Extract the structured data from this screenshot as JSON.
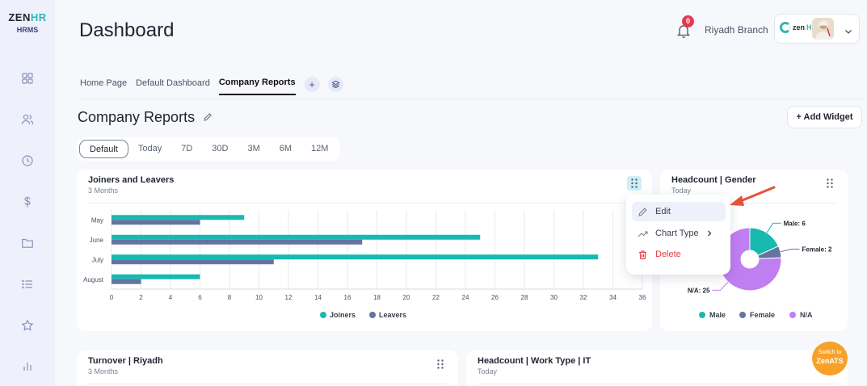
{
  "brand": {
    "logo_main": "ZEN",
    "logo_hr": "HR",
    "logo_sub": "HRMS"
  },
  "header": {
    "title": "Dashboard",
    "notifications_count": "0",
    "branch": "Riyadh Branch",
    "user_logo_text": "zen",
    "user_logo_hr": "HR"
  },
  "tabs": [
    {
      "label": "Home Page"
    },
    {
      "label": "Default Dashboard"
    },
    {
      "label": "Company Reports"
    }
  ],
  "tab_add": "+",
  "section": {
    "title": "Company Reports",
    "add_widget": "+ Add Widget"
  },
  "ranges": [
    {
      "label": "Default"
    },
    {
      "label": "Today"
    },
    {
      "label": "7D"
    },
    {
      "label": "30D"
    },
    {
      "label": "3M"
    },
    {
      "label": "6M"
    },
    {
      "label": "12M"
    }
  ],
  "cards": {
    "joiners": {
      "title": "Joiners and Leavers",
      "subtitle": "3 Months"
    },
    "gender": {
      "title": "Headcount | Gender",
      "subtitle": "Today"
    },
    "turnover": {
      "title": "Turnover | Riyadh",
      "subtitle": "3 Months"
    },
    "worktype": {
      "title": "Headcount | Work Type | IT",
      "subtitle": "Today"
    }
  },
  "context_menu": {
    "edit": "Edit",
    "chart_type": "Chart Type",
    "delete": "Delete"
  },
  "switch_ats": {
    "line1": "Switch to",
    "line2": "ZenATS"
  },
  "colors": {
    "teal": "#17b9b1",
    "slate": "#6474a0",
    "purple": "#c07ff1",
    "danger": "#e5393f",
    "accent_orange": "#f7a12a"
  },
  "chart_data": [
    {
      "type": "bar",
      "orientation": "horizontal",
      "categories": [
        "May",
        "June",
        "July",
        "August"
      ],
      "series": [
        {
          "name": "Joiners",
          "values": [
            9,
            25,
            33,
            6
          ],
          "color": "#17b9b1"
        },
        {
          "name": "Leavers",
          "values": [
            6,
            17,
            11,
            2
          ],
          "color": "#6474a0"
        }
      ],
      "xlim": [
        0,
        36
      ],
      "xticks": [
        0,
        2,
        4,
        6,
        8,
        10,
        12,
        14,
        16,
        18,
        20,
        22,
        24,
        26,
        28,
        30,
        32,
        34,
        36
      ],
      "grid": true,
      "legend": "bottom"
    },
    {
      "type": "pie",
      "donut": true,
      "slices": [
        {
          "name": "Male",
          "value": 6,
          "label": "Male: 6",
          "color": "#17b9b1"
        },
        {
          "name": "Female",
          "value": 2,
          "label": "Female: 2",
          "color": "#6474a0"
        },
        {
          "name": "N/A",
          "value": 25,
          "label": "N/A: 25",
          "color": "#c07ff1"
        }
      ],
      "legend": "bottom"
    }
  ]
}
